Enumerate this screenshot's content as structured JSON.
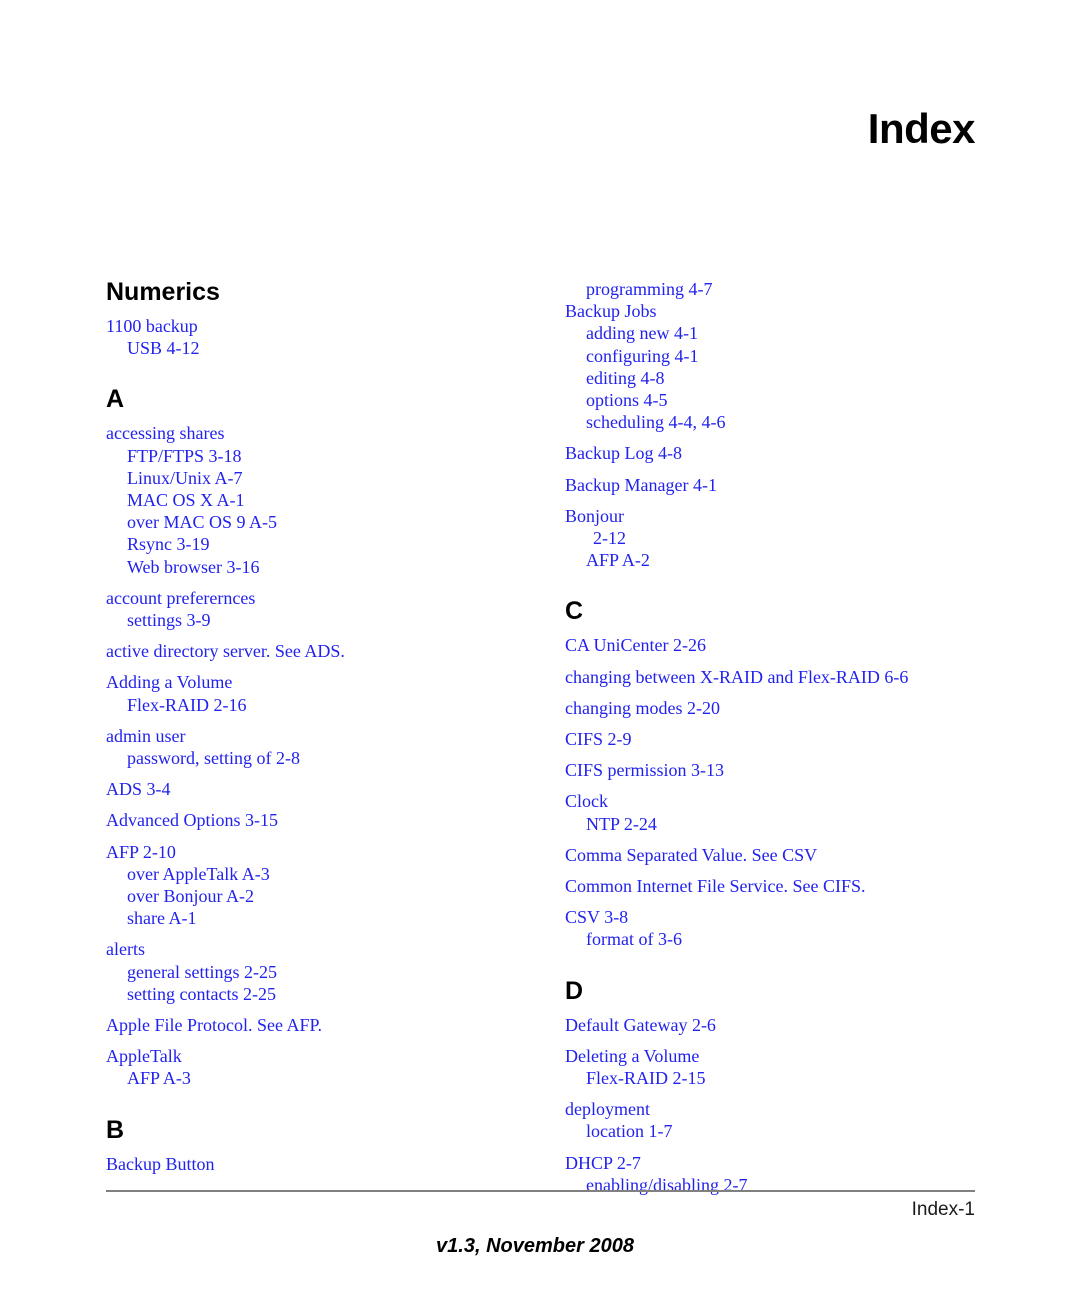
{
  "header": {
    "title": "Index"
  },
  "footer": {
    "page_label": "Index-1",
    "version": "v1.3, November 2008"
  },
  "columns": [
    {
      "name": "left-column",
      "sections": [
        {
          "heading": "Numerics",
          "heading_style": "word",
          "entries": [
            {
              "level": 1,
              "text": "1100 backup"
            },
            {
              "level": 2,
              "text": "USB  4-12"
            }
          ]
        },
        {
          "heading": "A",
          "heading_style": "letter",
          "entries": [
            {
              "level": 1,
              "text": "accessing shares"
            },
            {
              "level": 2,
              "text": "FTP/FTPS  3-18"
            },
            {
              "level": 2,
              "text": "Linux/Unix  A-7"
            },
            {
              "level": 2,
              "text": "MAC OS X  A-1"
            },
            {
              "level": 2,
              "text": "over MAC OS 9  A-5"
            },
            {
              "level": 2,
              "text": "Rsync  3-19"
            },
            {
              "level": 2,
              "text": "Web browser  3-16"
            },
            {
              "level": 1,
              "text": "account preferernces",
              "gap_before": true
            },
            {
              "level": 2,
              "text": "settings  3-9"
            },
            {
              "level": 1,
              "text": "active directory server. See ADS.",
              "gap_before": true
            },
            {
              "level": 1,
              "text": "Adding a Volume",
              "gap_before": true
            },
            {
              "level": 2,
              "text": "Flex-RAID  2-16"
            },
            {
              "level": 1,
              "text": "admin user",
              "gap_before": true
            },
            {
              "level": 2,
              "text": "password, setting of  2-8"
            },
            {
              "level": 1,
              "text": "ADS  3-4",
              "gap_before": true
            },
            {
              "level": 1,
              "text": "Advanced Options  3-15",
              "gap_before": true
            },
            {
              "level": 1,
              "text": "AFP  2-10",
              "gap_before": true
            },
            {
              "level": 2,
              "text": "over AppleTalk  A-3"
            },
            {
              "level": 2,
              "text": "over Bonjour  A-2"
            },
            {
              "level": 2,
              "text": "share  A-1"
            },
            {
              "level": 1,
              "text": "alerts",
              "gap_before": true
            },
            {
              "level": 2,
              "text": "general settings  2-25"
            },
            {
              "level": 2,
              "text": "setting contacts  2-25"
            },
            {
              "level": 1,
              "text": "Apple File Protocol. See AFP.",
              "gap_before": true
            },
            {
              "level": 1,
              "text": "AppleTalk",
              "gap_before": true
            },
            {
              "level": 2,
              "text": "AFP  A-3"
            }
          ]
        },
        {
          "heading": "B",
          "heading_style": "letter",
          "entries": [
            {
              "level": 1,
              "text": "Backup Button"
            }
          ]
        }
      ]
    },
    {
      "name": "right-column",
      "sections": [
        {
          "heading": "",
          "heading_style": "none",
          "entries": [
            {
              "level": 2,
              "text": "programming  4-7"
            },
            {
              "level": 1,
              "text": "Backup Jobs"
            },
            {
              "level": 2,
              "text": "adding new  4-1"
            },
            {
              "level": 2,
              "text": "configuring  4-1"
            },
            {
              "level": 2,
              "text": "editing  4-8"
            },
            {
              "level": 2,
              "text": "options  4-5"
            },
            {
              "level": 2,
              "text": "scheduling  4-4, 4-6"
            },
            {
              "level": 1,
              "text": "Backup Log  4-8",
              "gap_before": true
            },
            {
              "level": 1,
              "text": "Backup Manager  4-1",
              "gap_before": true
            },
            {
              "level": 1,
              "text": "Bonjour",
              "gap_before": true
            },
            {
              "level": 3,
              "text": "2-12"
            },
            {
              "level": 2,
              "text": "AFP  A-2"
            }
          ]
        },
        {
          "heading": "C",
          "heading_style": "letter",
          "entries": [
            {
              "level": 1,
              "text": "CA UniCenter  2-26"
            },
            {
              "level": 1,
              "text": "changing between X-RAID and Flex-RAID  6-6",
              "gap_before": true
            },
            {
              "level": 1,
              "text": "changing modes  2-20",
              "gap_before": true
            },
            {
              "level": 1,
              "text": "CIFS  2-9",
              "gap_before": true
            },
            {
              "level": 1,
              "text": "CIFS permission  3-13",
              "gap_before": true
            },
            {
              "level": 1,
              "text": "Clock",
              "gap_before": true
            },
            {
              "level": 2,
              "text": "NTP  2-24"
            },
            {
              "level": 1,
              "text": "Comma Separated Value. See CSV",
              "gap_before": true
            },
            {
              "level": 1,
              "text": "Common Internet File Service. See CIFS.",
              "gap_before": true
            },
            {
              "level": 1,
              "text": "CSV  3-8",
              "gap_before": true
            },
            {
              "level": 2,
              "text": "format of  3-6"
            }
          ]
        },
        {
          "heading": "D",
          "heading_style": "letter",
          "entries": [
            {
              "level": 1,
              "text": "Default Gateway  2-6"
            },
            {
              "level": 1,
              "text": "Deleting a Volume",
              "gap_before": true
            },
            {
              "level": 2,
              "text": "Flex-RAID  2-15"
            },
            {
              "level": 1,
              "text": "deployment",
              "gap_before": true
            },
            {
              "level": 2,
              "text": "location  1-7"
            },
            {
              "level": 1,
              "text": "DHCP  2-7",
              "gap_before": true
            },
            {
              "level": 2,
              "text": "enabling/disabling  2-7"
            }
          ]
        }
      ]
    }
  ],
  "colors": {
    "entry_text": "#2222ee",
    "heading_text": "#000000",
    "rule": "#808080",
    "background": "#ffffff"
  }
}
